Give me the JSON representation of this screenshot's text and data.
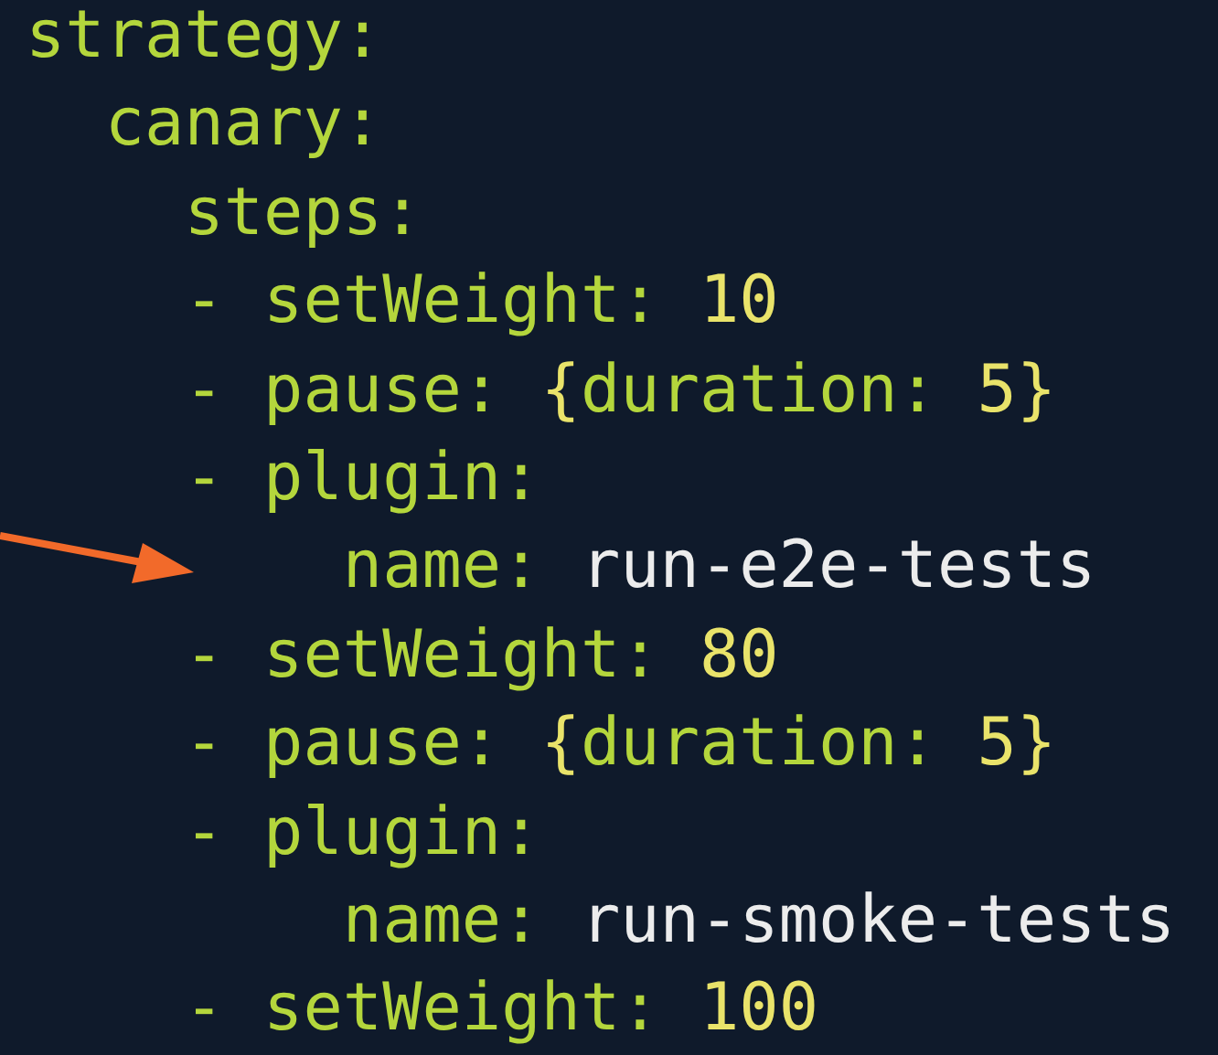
{
  "editor": {
    "lines": [
      {
        "tokens": [
          {
            "kind": "key",
            "text": "strategy:"
          }
        ]
      },
      {
        "tokens": [
          {
            "kind": "key",
            "text": "  canary:"
          }
        ]
      },
      {
        "tokens": [
          {
            "kind": "key",
            "text": "    steps:"
          }
        ]
      },
      {
        "tokens": [
          {
            "kind": "key",
            "text": "    - setWeight: "
          },
          {
            "kind": "number",
            "text": "10"
          }
        ]
      },
      {
        "tokens": [
          {
            "kind": "key",
            "text": "    - pause: "
          },
          {
            "kind": "punct",
            "text": "{"
          },
          {
            "kind": "key",
            "text": "duration: "
          },
          {
            "kind": "number",
            "text": "5"
          },
          {
            "kind": "punct",
            "text": "}"
          }
        ]
      },
      {
        "tokens": [
          {
            "kind": "key",
            "text": "    - plugin:"
          }
        ]
      },
      {
        "tokens": [
          {
            "kind": "key",
            "text": "        name: "
          },
          {
            "kind": "string",
            "text": "run-e2e-tests"
          }
        ]
      },
      {
        "tokens": [
          {
            "kind": "key",
            "text": "    - setWeight: "
          },
          {
            "kind": "number",
            "text": "80"
          }
        ]
      },
      {
        "tokens": [
          {
            "kind": "key",
            "text": "    - pause: "
          },
          {
            "kind": "punct",
            "text": "{"
          },
          {
            "kind": "key",
            "text": "duration: "
          },
          {
            "kind": "number",
            "text": "5"
          },
          {
            "kind": "punct",
            "text": "}"
          }
        ]
      },
      {
        "tokens": [
          {
            "kind": "key",
            "text": "    - plugin:"
          }
        ]
      },
      {
        "tokens": [
          {
            "kind": "key",
            "text": "        name: "
          },
          {
            "kind": "string",
            "text": "run-smoke-tests"
          }
        ]
      },
      {
        "tokens": [
          {
            "kind": "key",
            "text": "    - setWeight: "
          },
          {
            "kind": "number",
            "text": "100"
          }
        ]
      }
    ]
  }
}
